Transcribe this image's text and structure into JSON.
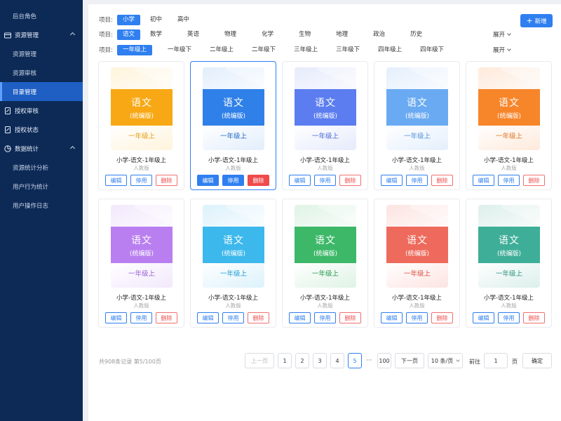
{
  "sidebar": {
    "items": [
      {
        "label": "后台角色",
        "kind": "sub"
      },
      {
        "label": "资源管理",
        "kind": "group",
        "icon": "folder-icon",
        "chevron": "up"
      },
      {
        "label": "资源管理",
        "kind": "sub"
      },
      {
        "label": "资源审核",
        "kind": "sub"
      },
      {
        "label": "目录管理",
        "kind": "sub",
        "active": true
      },
      {
        "label": "授权审核",
        "kind": "group",
        "icon": "document-icon"
      },
      {
        "label": "授权状态",
        "kind": "group",
        "icon": "document-icon"
      },
      {
        "label": "数据统计",
        "kind": "group",
        "icon": "pie-chart-icon",
        "chevron": "up"
      },
      {
        "label": "资源统计分析",
        "kind": "sub"
      },
      {
        "label": "用户行为统计",
        "kind": "sub"
      },
      {
        "label": "用户操作日志",
        "kind": "sub"
      }
    ]
  },
  "filters": {
    "label": "项目:",
    "stage": [
      "小学",
      "初中",
      "高中"
    ],
    "subject": [
      "语文",
      "数学",
      "英语",
      "物理",
      "化学",
      "生物",
      "地理",
      "政治",
      "历史"
    ],
    "grade": [
      "一年级上",
      "一年级下",
      "二年级上",
      "二年级下",
      "三年级上",
      "三年级下",
      "四年级上",
      "四年级下"
    ],
    "expand_label": "展开",
    "add_label": "新增"
  },
  "card_common": {
    "subject": "语文",
    "edition": "(统编版)",
    "grade": "一年级上",
    "title": "小学-语文-1年级上",
    "publisher": "人教版",
    "edit_label": "编辑",
    "stop_label": "停用",
    "delete_label": "删除"
  },
  "cards": [
    {
      "title": "小学-语文-1年级上",
      "publisher": "人教版",
      "color": "#f7a814",
      "light": "#fff4dc",
      "text": "#e69a10"
    },
    {
      "title": "小学-语文-1年级上",
      "publisher": "人教版",
      "color": "#2f80e8",
      "light": "#e2eefc",
      "text": "#1e66c8",
      "active": true
    },
    {
      "title": "小学-语文-1年级上",
      "publisher": "人教版",
      "color": "#5b7df0",
      "light": "#e6ebfc",
      "text": "#4767d8"
    },
    {
      "title": "小学-语文-1年级上",
      "publisher": "人教版",
      "color": "#6aaaf2",
      "light": "#e4effc",
      "text": "#4f90dc"
    },
    {
      "title": "小学-语文-1年级上",
      "publisher": "人教版",
      "color": "#f7852a",
      "light": "#feeadb",
      "text": "#e0711c"
    },
    {
      "title": "小学-语文-1年级上",
      "publisher": "人教版",
      "color": "#b97ff0",
      "light": "#f2e8fc",
      "text": "#9b5fd8"
    },
    {
      "title": "小学-语文-1年级上",
      "publisher": "人教版",
      "color": "#3cb8ec",
      "light": "#dcf2fb",
      "text": "#1e9ccf"
    },
    {
      "title": "小学-语文-1年级上",
      "publisher": "人教版",
      "color": "#3cb868",
      "light": "#dff3e5",
      "text": "#259a4e"
    },
    {
      "title": "小学-语文-1年级上",
      "publisher": "人教版",
      "color": "#ee6a5c",
      "light": "#fce4e1",
      "text": "#d84f40"
    },
    {
      "title": "小学-语文-1年级上",
      "publisher": "人教版",
      "color": "#3fae98",
      "light": "#dcefeb",
      "text": "#2a927d"
    }
  ],
  "pagination": {
    "total_text": "共908条记录 第5/100页",
    "prev_label": "上一页",
    "pages": [
      "1",
      "2",
      "3",
      "4",
      "5"
    ],
    "current": "5",
    "dots": "···",
    "last_page": "100",
    "next_label": "下一页",
    "page_size": "10 条/页",
    "goto_label": "前往",
    "goto_value": "1",
    "page_unit": "页",
    "confirm_label": "确定"
  }
}
